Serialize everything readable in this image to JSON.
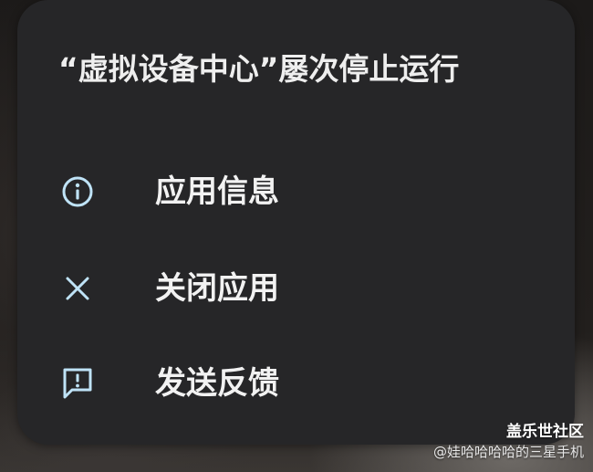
{
  "dialog": {
    "title": "“虚拟设备中心”屡次停止运行",
    "menu": [
      {
        "label": "应用信息",
        "icon": "info-icon"
      },
      {
        "label": "关闭应用",
        "icon": "close-icon"
      },
      {
        "label": "发送反馈",
        "icon": "feedback-icon"
      }
    ]
  },
  "watermark": {
    "brand": "盖乐世社区",
    "author": "@娃哈哈哈哈的三星手机"
  },
  "colors": {
    "dialog_background": "#262628",
    "icon_accent": "#bfe3f7",
    "text_primary": "#f2f2f2"
  }
}
